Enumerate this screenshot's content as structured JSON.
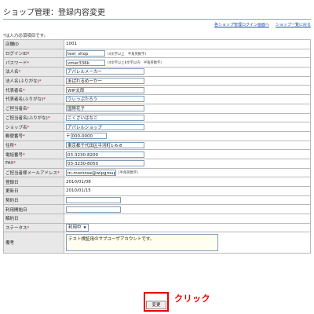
{
  "page": {
    "title": "ショップ管理：登録内容変更",
    "links": [
      "各ショップ管理ログイン画面へ",
      "ショップ一覧に戻る"
    ],
    "required_note": "*は入力必須項目です。"
  },
  "form": {
    "store_id": {
      "label": "店舗ID",
      "value": "1001"
    },
    "login_id": {
      "label": "ログインID",
      "required": "*",
      "value": "test_shop",
      "hint": "(4文字以上　半角英数字)"
    },
    "password": {
      "label": "パスワード",
      "required": "*",
      "value": "vmer336k",
      "hint": "(4文字以上8文字以内　半角英数字)"
    },
    "corp_name": {
      "label": "法人名",
      "required": "*",
      "value": "アパレルメーカー"
    },
    "corp_name_kana": {
      "label": "法人名(ふりがな)",
      "required": "*",
      "value": "あぱれるめーかー"
    },
    "rep_name": {
      "label": "代表者名",
      "required": "*",
      "value": "WIP太郎"
    },
    "rep_name_kana": {
      "label": "代表者名(ふりがな)",
      "required": "*",
      "value": "うぃっぷたろう"
    },
    "contact_name": {
      "label": "ご担当者名",
      "required": "*",
      "value": "国際花子"
    },
    "contact_name_kana": {
      "label": "ご担当者名(ふりがな)",
      "required": "*",
      "value": "こくさいはなこ"
    },
    "shop_name": {
      "label": "ショップ名",
      "required": "*",
      "value": "アパレルショップ"
    },
    "zip": {
      "label": "郵便番号",
      "required": "*",
      "prefix": "〒",
      "value": "000-0000"
    },
    "address": {
      "label": "住所",
      "required": "*",
      "value": "東京都千代田区平河町1-6-8"
    },
    "tel": {
      "label": "電話番号",
      "required": "*",
      "value": "03-3230-8200"
    },
    "fax": {
      "label": "FAX",
      "required": "*",
      "value": "03-3230-8050"
    },
    "email": {
      "label": "ご担当者様メールアドレス",
      "required": "*",
      "value": "m-momose@wipgroup.com",
      "hint": "(半角英数字)"
    },
    "registered": {
      "label": "登録日",
      "value": "2010/01/08"
    },
    "updated": {
      "label": "更新日",
      "value": "2010/01/15"
    },
    "contract_date": {
      "label": "契約日",
      "value": ""
    },
    "start_date": {
      "label": "利用開始日",
      "value": ""
    },
    "cancel_date": {
      "label": "解約日",
      "value": ""
    },
    "status": {
      "label": "ステータス",
      "required": "*",
      "value": "利用中"
    },
    "memo": {
      "label": "備考",
      "value": "テスト検証用のサブユーザアカウントです。"
    }
  },
  "actions": {
    "submit_label": "変更",
    "click_annotation": "クリック"
  },
  "colors": {
    "required": "#cc0000",
    "annotation": "#e60000",
    "link": "#1a4fb0",
    "label_bg": "#e8e8e8"
  }
}
